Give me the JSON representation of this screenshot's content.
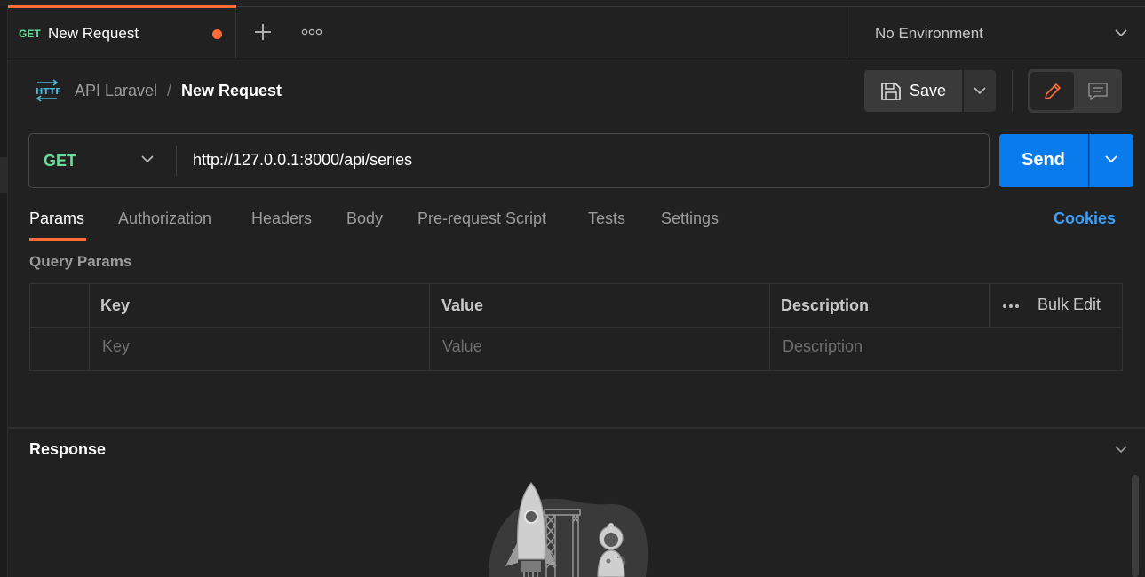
{
  "colors": {
    "accent_orange": "#ff6c37",
    "get_green": "#6bdd9a",
    "send_blue": "#097bed",
    "link_blue": "#3d9ff5",
    "background": "#212121"
  },
  "tabbar": {
    "active_tab": {
      "method": "GET",
      "name": "New Request",
      "unsaved": true
    },
    "new_tab_icon": "plus-icon",
    "more_icon": "more-horizontal-icon",
    "environment": "No Environment"
  },
  "breadcrumb": {
    "icon": "http-icon",
    "parent": "API Laravel",
    "separator": "/",
    "title": "New Request"
  },
  "toolbar": {
    "save_label": "Save",
    "save_icon": "floppy-disk-icon",
    "edit_icon": "pencil-icon",
    "comment_icon": "comment-icon"
  },
  "request": {
    "method": "GET",
    "url": "http://127.0.0.1:8000/api/series",
    "send_label": "Send"
  },
  "request_tabs": [
    {
      "label": "Params",
      "active": true
    },
    {
      "label": "Authorization",
      "active": false
    },
    {
      "label": "Headers",
      "active": false
    },
    {
      "label": "Body",
      "active": false
    },
    {
      "label": "Pre-request Script",
      "active": false
    },
    {
      "label": "Tests",
      "active": false
    },
    {
      "label": "Settings",
      "active": false
    }
  ],
  "cookies_label": "Cookies",
  "query_params": {
    "title": "Query Params",
    "columns": [
      "Key",
      "Value",
      "Description"
    ],
    "bulk_edit_label": "Bulk Edit",
    "placeholders": {
      "key": "Key",
      "value": "Value",
      "description": "Description"
    }
  },
  "response": {
    "title": "Response",
    "illustration": "rocket-astronaut-illustration"
  }
}
